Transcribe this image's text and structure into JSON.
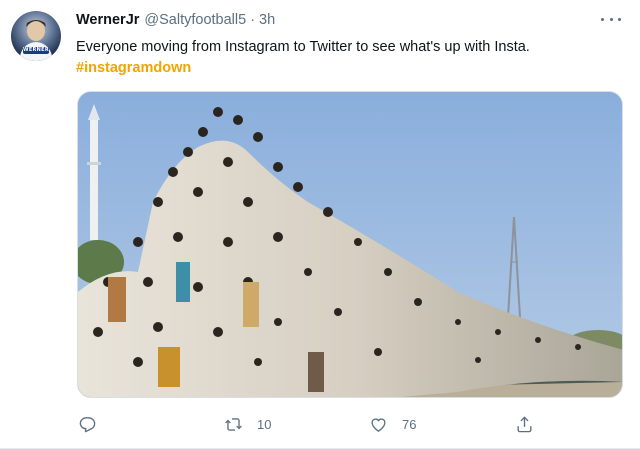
{
  "tweet": {
    "display_name": "WernerJr",
    "handle": "@Saltyfootball5",
    "separator": "·",
    "timestamp": "3h",
    "text": "Everyone moving from Instagram to Twitter to see what's up with Insta.",
    "hashtag": "#instagramdown",
    "avatar_badge": "WERNER",
    "colors": {
      "hashtag": "#f0a500",
      "muted": "#5b7083"
    }
  },
  "actions": {
    "reply": {
      "icon": "reply-icon"
    },
    "retweet": {
      "icon": "retweet-icon",
      "count": "10"
    },
    "like": {
      "icon": "heart-icon",
      "count": "76"
    },
    "share": {
      "icon": "share-icon"
    }
  }
}
